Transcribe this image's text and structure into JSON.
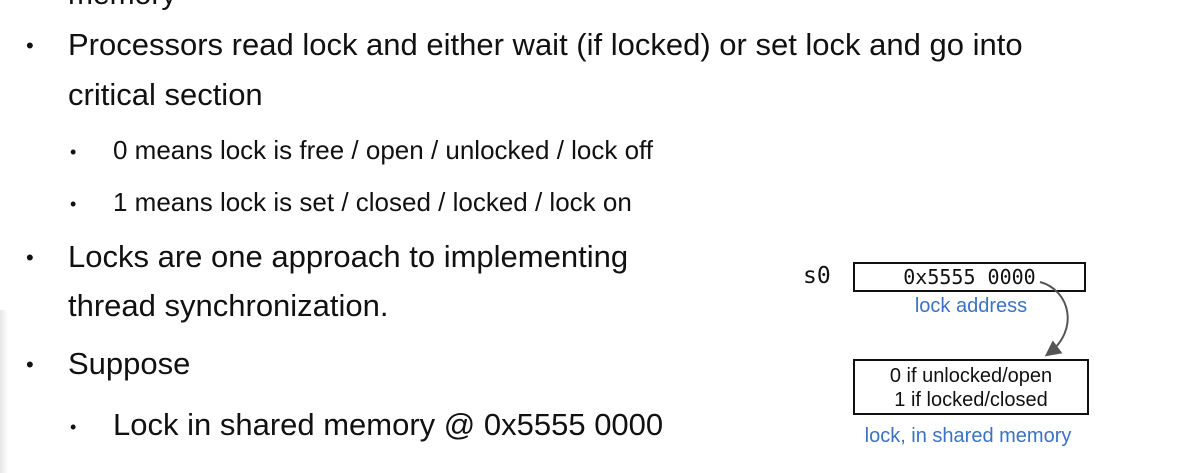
{
  "top_fragment": "memory",
  "bullets": [
    {
      "line1": "Processors read lock and either wait (if locked) or set lock and go into",
      "line2": "critical section",
      "sub": [
        "0 means lock is free / open / unlocked / lock off",
        "1 means lock is set / closed / locked / lock on"
      ]
    },
    {
      "line1": "Locks are one approach to implementing",
      "line2": "thread synchronization."
    },
    {
      "line1": "Suppose",
      "sub": [
        "Lock in shared memory @ 0x5555 0000"
      ]
    }
  ],
  "bullet_glyph": "•",
  "diagram": {
    "register_name": "s0",
    "register_value": "0x5555 0000",
    "register_caption": "lock address",
    "memory_line1": "0 if unlocked/open",
    "memory_line2": "1 if locked/closed",
    "memory_caption": "lock, in shared memory",
    "caption_color": "#3b72c4",
    "arrow_color": "#555555"
  }
}
